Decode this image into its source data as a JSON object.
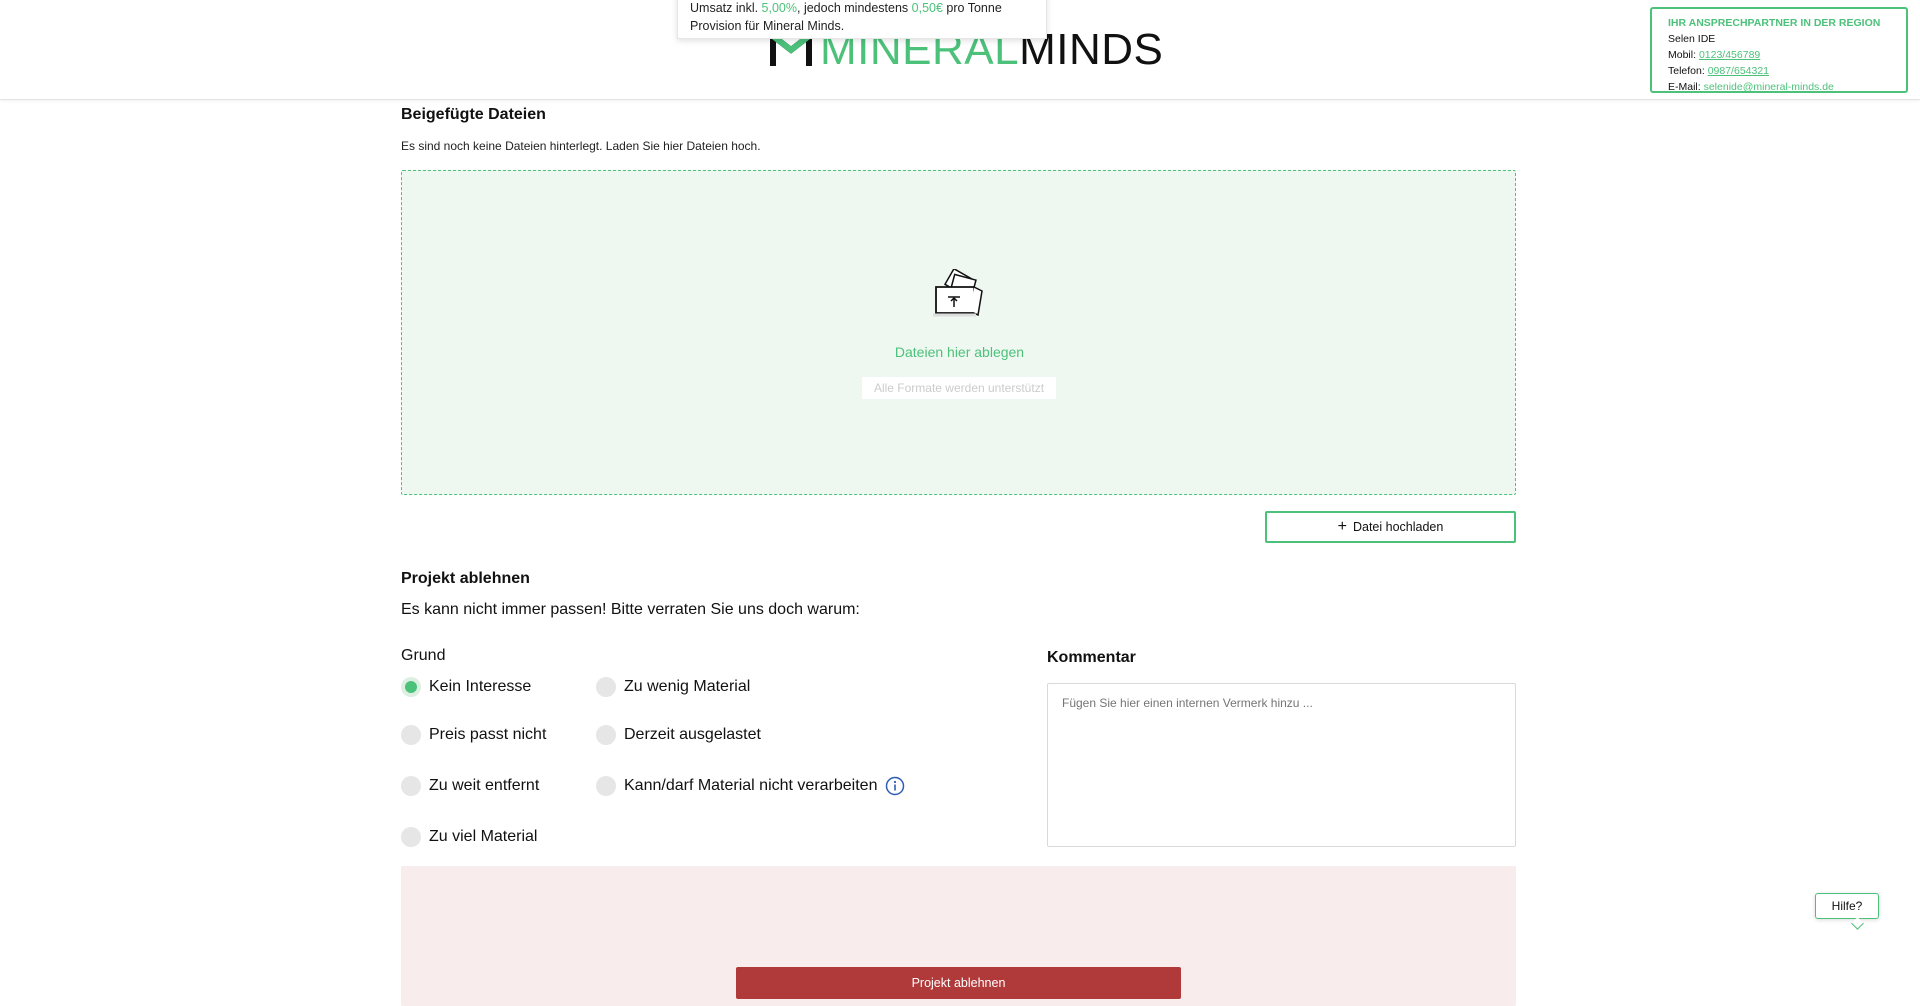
{
  "header": {
    "logo_part1": "MINERAL",
    "logo_part2": "MINDS",
    "tooltip": {
      "text_before": "Umsatz inkl. ",
      "percent": "5,00%",
      "text_middle": ", jedoch mindestens ",
      "minimum": "0,50€",
      "text_after": " pro Tonne",
      "line2": "Provision für Mineral Minds."
    },
    "contact": {
      "title": "IHR ANSPRECHPARTNER IN DER REGION",
      "name": "Selen IDE",
      "mobile_label": "Mobil: ",
      "mobile": "0123/456789",
      "phone_label": "Telefon: ",
      "phone": "0987/654321",
      "email_label": "E-Mail: ",
      "email": "selenide@mineral-minds.de"
    }
  },
  "files": {
    "title": "Beigefügte Dateien",
    "empty_text": "Es sind noch keine Dateien hinterlegt. Laden Sie hier Dateien hoch.",
    "dropzone_label": "Dateien hier ablegen",
    "dropzone_hint": "Alle Formate werden unterstützt",
    "upload_button": "Datei hochladen",
    "plus_glyph": "+"
  },
  "reject": {
    "title": "Projekt ablehnen",
    "question": "Es kann nicht immer passen! Bitte verraten Sie uns doch warum:",
    "grund_label": "Grund",
    "reasons": [
      {
        "label": "Kein Interesse",
        "selected": true
      },
      {
        "label": "Zu wenig Material",
        "selected": false
      },
      {
        "label": "Preis passt nicht",
        "selected": false
      },
      {
        "label": "Derzeit ausgelastet",
        "selected": false
      },
      {
        "label": "Zu weit entfernt",
        "selected": false
      },
      {
        "label": "Kann/darf Material nicht verarbeiten",
        "selected": false
      },
      {
        "label": "Zu viel Material",
        "selected": false
      }
    ],
    "comment_label": "Kommentar",
    "comment_placeholder": "Fügen Sie hier einen internen Vermerk hinzu ...",
    "reject_button": "Projekt ablehnen"
  },
  "help": {
    "label": "Hilfe?"
  },
  "colors": {
    "brand_green": "#4cc17a",
    "reject_red": "#b0393a",
    "reject_bg": "#f8ecec",
    "dropzone_bg": "#eef8f1"
  },
  "icons": {
    "logo": "mineral-minds-logo-mark",
    "dropzone": "upload-folder-icon",
    "info": "info-icon",
    "plus": "plus-icon"
  }
}
